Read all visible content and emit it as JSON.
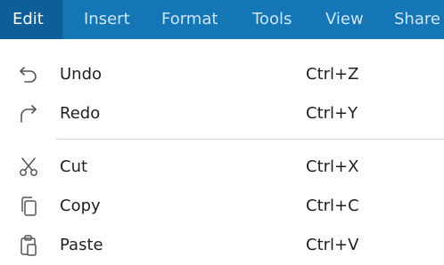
{
  "menubar": {
    "tabs": [
      {
        "label": "Edit"
      },
      {
        "label": "Insert"
      },
      {
        "label": "Format"
      },
      {
        "label": "Tools"
      },
      {
        "label": "View"
      },
      {
        "label": "Share"
      }
    ],
    "active_tab": "Edit",
    "background_color": "#1576b6",
    "active_color": "#0e5f97"
  },
  "dropdown": {
    "items": [
      {
        "label": "Undo",
        "shortcut": "Ctrl+Z",
        "icon": "undo-icon"
      },
      {
        "label": "Redo",
        "shortcut": "Ctrl+Y",
        "icon": "redo-icon"
      },
      {
        "label": "Cut",
        "shortcut": "Ctrl+X",
        "icon": "cut-icon"
      },
      {
        "label": "Copy",
        "shortcut": "Ctrl+C",
        "icon": "copy-icon"
      },
      {
        "label": "Paste",
        "shortcut": "Ctrl+V",
        "icon": "paste-icon"
      }
    ]
  }
}
